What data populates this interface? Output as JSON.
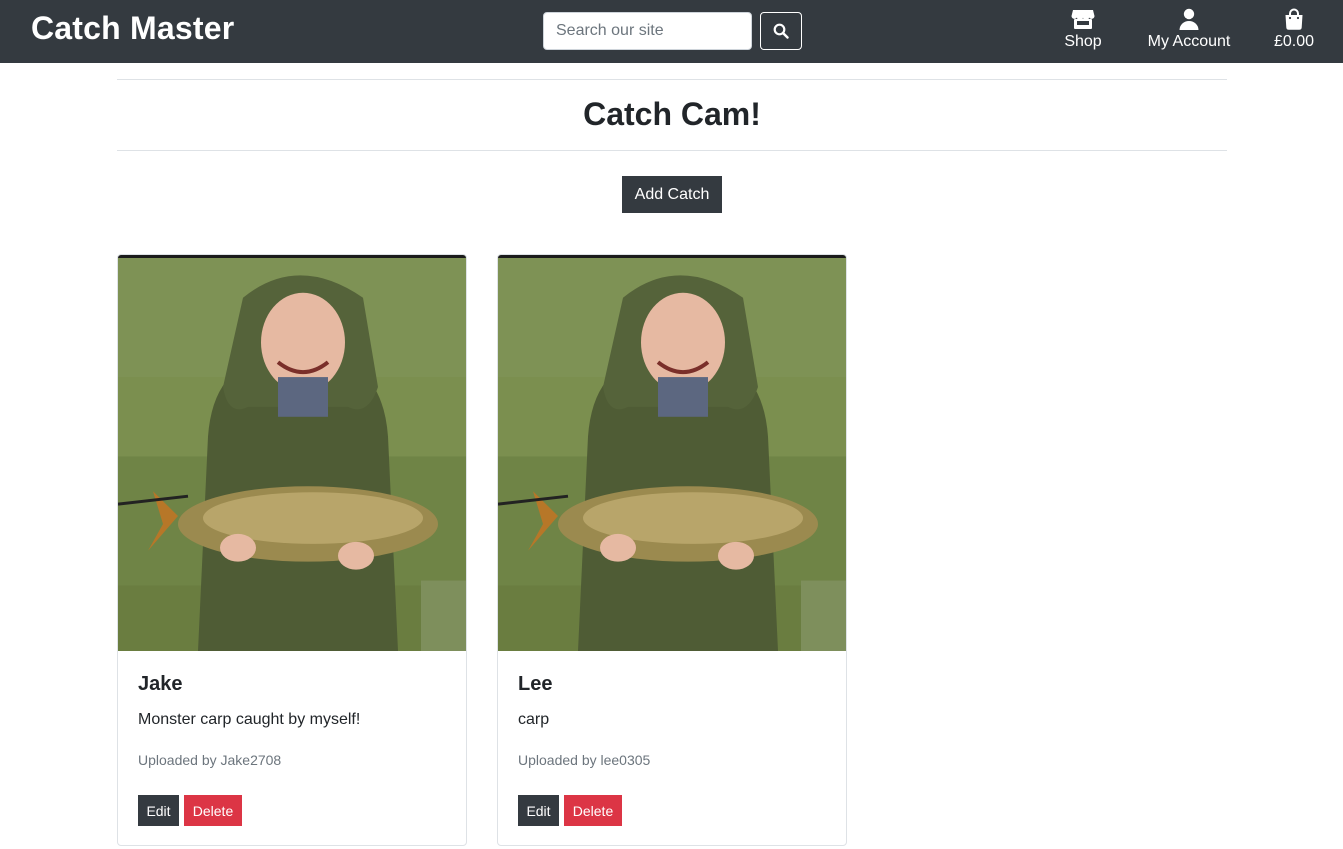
{
  "header": {
    "brand": "Catch Master",
    "search_placeholder": "Search our site",
    "search_icon": "search-icon",
    "nav": [
      {
        "label": "Shop",
        "icon": "store-icon"
      },
      {
        "label": "My Account",
        "icon": "user-icon"
      },
      {
        "label": "£0.00",
        "icon": "shopping-bag-icon"
      }
    ]
  },
  "main": {
    "title": "Catch Cam!",
    "add_button": "Add Catch"
  },
  "catches": [
    {
      "name": "Jake",
      "description": "Monster carp caught by myself!",
      "uploaded_by": "Uploaded by Jake2708",
      "edit_label": "Edit",
      "delete_label": "Delete"
    },
    {
      "name": "Lee",
      "description": "carp",
      "uploaded_by": "Uploaded by lee0305",
      "edit_label": "Edit",
      "delete_label": "Delete"
    }
  ],
  "colors": {
    "navbar": "#343a40",
    "danger": "#dc3545",
    "muted": "#6c757d"
  }
}
